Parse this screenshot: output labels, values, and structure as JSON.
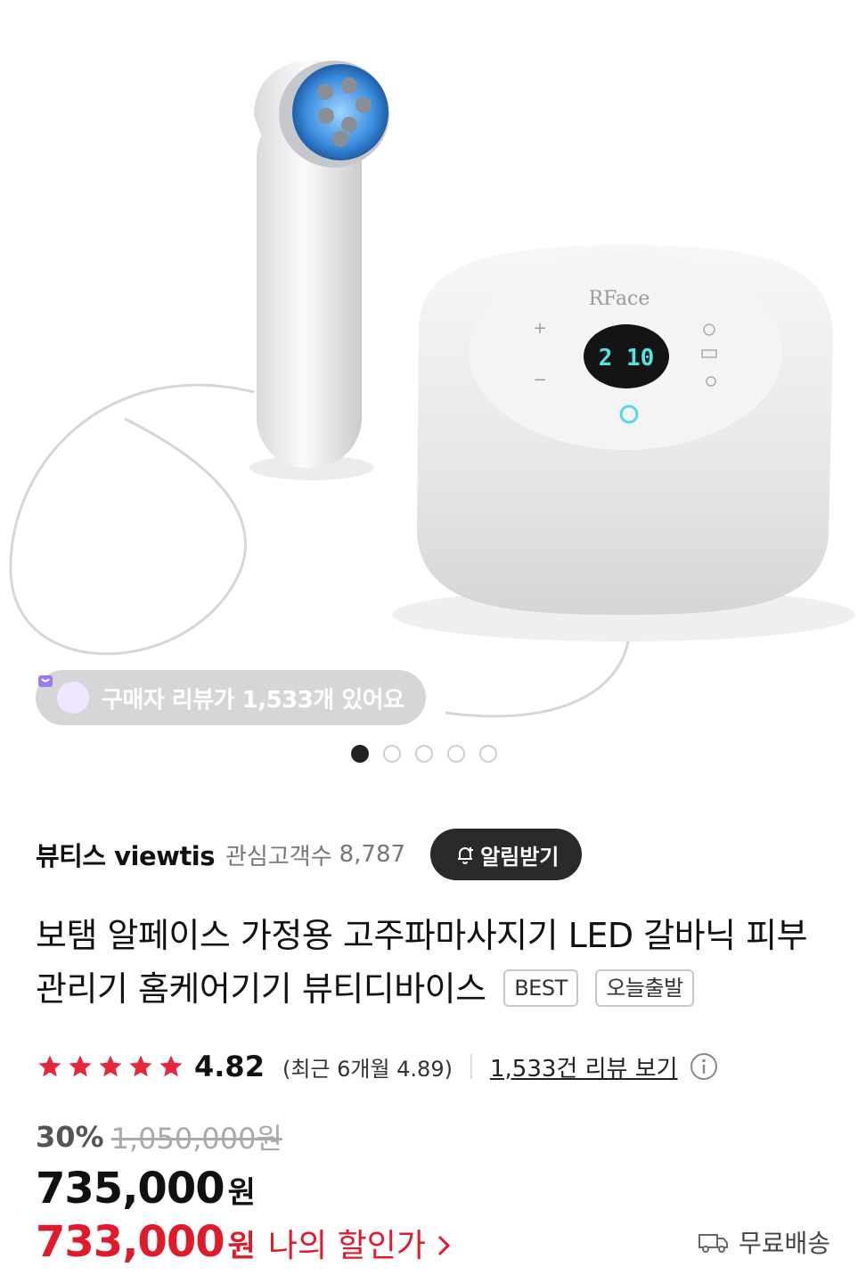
{
  "hero": {
    "device_display": "2 10",
    "brand_logo": "RFace",
    "review_pill_text": "구매자 리뷰가 1,533개 있어요",
    "carousel_total": 5,
    "carousel_active": 1
  },
  "seller": {
    "name": "뷰티스 viewtis",
    "interest_label": "관심고객수",
    "interest_count": "8,787",
    "alert_button": "알림받기"
  },
  "product": {
    "title": "보탬 알페이스 가정용 고주파마사지기 LED 갈바닉 피부관리기 홈케어기기 뷰티디바이스",
    "badges": [
      "BEST",
      "오늘출발"
    ]
  },
  "rating": {
    "stars": 5,
    "value": "4.82",
    "recent": "(최근 6개월 4.89)",
    "review_link": "1,533건 리뷰 보기"
  },
  "price": {
    "discount": "30%",
    "original": "1,050,000원",
    "current": "735,000",
    "currency": "원",
    "my_discount_price": "733,000",
    "my_discount_currency": "원",
    "my_discount_label": "나의 할인가",
    "shipping": "무료배송"
  },
  "colors": {
    "accent_red": "#e0192b",
    "star_red": "#e8283a",
    "dark_button": "#2a2a2a"
  }
}
